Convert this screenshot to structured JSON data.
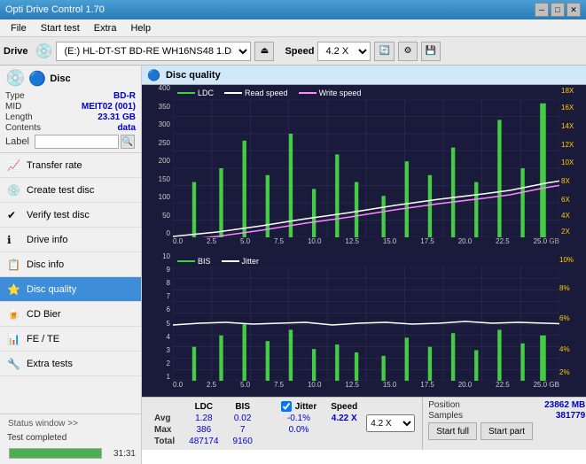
{
  "titlebar": {
    "title": "Opti Drive Control 1.70",
    "minimize": "─",
    "maximize": "□",
    "close": "✕"
  },
  "menubar": {
    "items": [
      "File",
      "Start test",
      "Extra",
      "Help"
    ]
  },
  "toolbar": {
    "drive_label": "Drive",
    "drive_value": "(E:)  HL-DT-ST BD-RE  WH16NS48 1.D3",
    "speed_label": "Speed",
    "speed_value": "4.2 X"
  },
  "disc": {
    "title": "Disc",
    "type_label": "Type",
    "type_value": "BD-R",
    "mid_label": "MID",
    "mid_value": "MEIT02 (001)",
    "length_label": "Length",
    "length_value": "23.31 GB",
    "contents_label": "Contents",
    "contents_value": "data",
    "label_label": "Label",
    "label_value": ""
  },
  "nav": {
    "items": [
      {
        "id": "transfer-rate",
        "label": "Transfer rate",
        "icon": "📈",
        "active": false
      },
      {
        "id": "create-test-disc",
        "label": "Create test disc",
        "icon": "💿",
        "active": false
      },
      {
        "id": "verify-test-disc",
        "label": "Verify test disc",
        "icon": "✔",
        "active": false
      },
      {
        "id": "drive-info",
        "label": "Drive info",
        "icon": "ℹ",
        "active": false
      },
      {
        "id": "disc-info",
        "label": "Disc info",
        "icon": "📋",
        "active": false
      },
      {
        "id": "disc-quality",
        "label": "Disc quality",
        "icon": "⭐",
        "active": true
      },
      {
        "id": "cd-bier",
        "label": "CD Bier",
        "icon": "🍺",
        "active": false
      },
      {
        "id": "fe-te",
        "label": "FE / TE",
        "icon": "📊",
        "active": false
      },
      {
        "id": "extra-tests",
        "label": "Extra tests",
        "icon": "🔧",
        "active": false
      }
    ]
  },
  "status": {
    "window_btn": "Status window >>",
    "text": "Test completed",
    "progress": 100,
    "time": "31:31"
  },
  "disc_quality": {
    "title": "Disc quality",
    "legend": {
      "ldc": "LDC",
      "read_speed": "Read speed",
      "write_speed": "Write speed",
      "bis": "BIS",
      "jitter": "Jitter"
    },
    "chart1": {
      "y_labels": [
        "400",
        "350",
        "300",
        "250",
        "200",
        "150",
        "100",
        "50",
        "0"
      ],
      "y_labels_right": [
        "18X",
        "16X",
        "14X",
        "12X",
        "10X",
        "8X",
        "6X",
        "4X",
        "2X"
      ],
      "x_labels": [
        "0.0",
        "2.5",
        "5.0",
        "7.5",
        "10.0",
        "12.5",
        "15.0",
        "17.5",
        "20.0",
        "22.5",
        "25.0"
      ],
      "x_unit": "GB"
    },
    "chart2": {
      "y_labels": [
        "10",
        "9",
        "8",
        "7",
        "6",
        "5",
        "4",
        "3",
        "2",
        "1"
      ],
      "y_labels_right": [
        "10%",
        "8%",
        "6%",
        "4%",
        "2%"
      ],
      "x_labels": [
        "0.0",
        "2.5",
        "5.0",
        "7.5",
        "10.0",
        "12.5",
        "15.0",
        "17.5",
        "20.0",
        "22.5",
        "25.0"
      ],
      "x_unit": "GB"
    },
    "stats": {
      "headers": [
        "",
        "LDC",
        "BIS",
        "",
        "Jitter",
        "Speed",
        ""
      ],
      "avg_label": "Avg",
      "avg_ldc": "1.28",
      "avg_bis": "0.02",
      "avg_jitter": "-0.1%",
      "max_label": "Max",
      "max_ldc": "386",
      "max_bis": "7",
      "max_jitter": "0.0%",
      "total_label": "Total",
      "total_ldc": "487174",
      "total_bis": "9160",
      "speed_label": "Speed",
      "speed_value": "4.22 X",
      "position_label": "Position",
      "position_value": "23862 MB",
      "samples_label": "Samples",
      "samples_value": "381779",
      "jitter_checked": true,
      "speed_select": "4.2 X",
      "start_full": "Start full",
      "start_part": "Start part"
    }
  }
}
